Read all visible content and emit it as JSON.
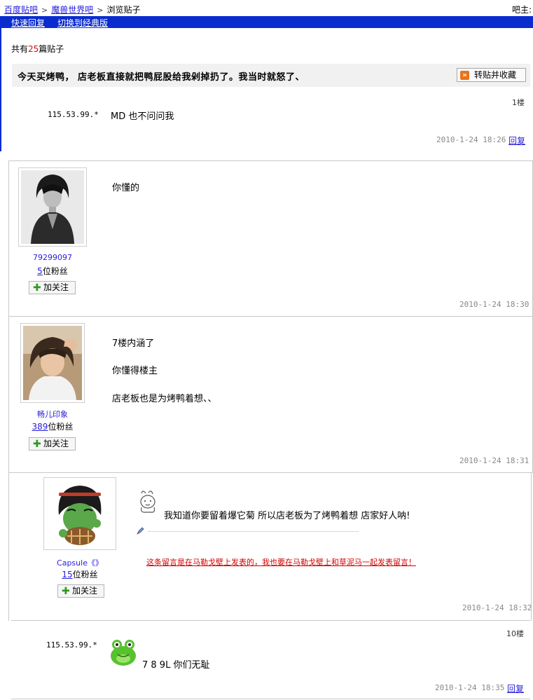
{
  "breadcrumb": {
    "home": "百度贴吧",
    "forum": "魔兽世界吧",
    "current": "浏览贴子",
    "separator": ">"
  },
  "admin_label": "吧主:",
  "toolbar": {
    "quick_reply": "快速回复",
    "switch_classic": "切换到经典版"
  },
  "summary": {
    "prefix": "共有",
    "count": "25",
    "suffix": "篇贴子"
  },
  "thread": {
    "title": "今天买烤鸭， 店老板直接就把鸭屁股给我剁掉扔了。我当时就怒了、",
    "favorite_button": "转贴并收藏"
  },
  "posts": [
    {
      "floor": "1楼",
      "author_ip": "115.53.99.*",
      "content": "MD 也不问问我",
      "time": "2010-1-24 18:26",
      "reply": "回复"
    },
    {
      "username": "79299097",
      "fans_count": "5",
      "fans_suffix": "位粉丝",
      "follow": "加关注",
      "content": "你懂的",
      "time": "2010-1-24 18:30"
    },
    {
      "username": "畅儿印象",
      "fans_count": "389",
      "fans_suffix": "位粉丝",
      "follow": "加关注",
      "content_lines": [
        "7楼内涵了",
        "你懂得楼主",
        "店老板也是为烤鸭着想、、"
      ],
      "time": "2010-1-24 18:31"
    },
    {
      "username": "Capsule《》",
      "fans_count": "15",
      "fans_suffix": "位粉丝",
      "follow": "加关注",
      "content": "我知道你要留着爆它菊 所以店老板为了烤鸭着想 店家好人呐!",
      "signature_link": "这条留言是在马勒戈壁上发表的，我也要在马勒戈壁上和草泥马一起发表留言！",
      "time": "2010-1-24 18:32"
    },
    {
      "floor": "10楼",
      "author_ip": "115.53.99.*",
      "content": "7 8   9L    你们无耻",
      "time": "2010-1-24 18:35",
      "reply": "回复"
    }
  ],
  "colors": {
    "link": "#261cdc",
    "bar": "#0a2ccf",
    "count_red": "#e10602",
    "signature_red": "#d40000"
  }
}
